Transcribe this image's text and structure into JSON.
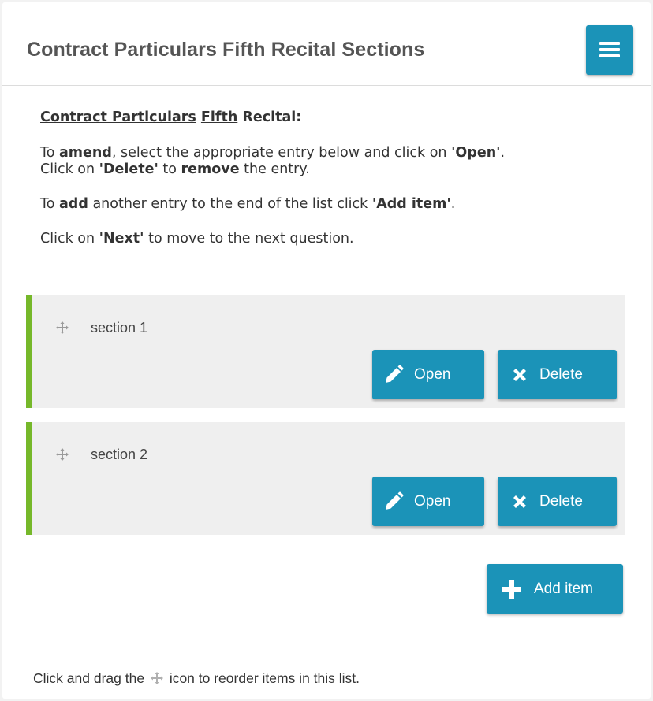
{
  "header": {
    "title": "Contract Particulars Fifth Recital Sections",
    "menu_icon": "hamburger-menu-icon"
  },
  "instructions": {
    "heading_part1": "Contract Particulars",
    "heading_part2": "Fifth",
    "heading_part3": "Recital:",
    "line1_prefix": "To ",
    "line1_amend": "amend",
    "line1_mid": ", select the appropriate entry below and click on ",
    "line1_open": "'Open'",
    "line1_end": ".",
    "line2_prefix": "Click on ",
    "line2_delete": "'Delete'",
    "line2_mid": " to ",
    "line2_remove": "remove",
    "line2_end": " the entry.",
    "line3_prefix": "To ",
    "line3_add": "add",
    "line3_mid": " another entry to the end of the list click ",
    "line3_additem": "'Add item'",
    "line3_end": ".",
    "line4_prefix": "Click on ",
    "line4_next": "'Next'",
    "line4_end": " to move to the next question."
  },
  "items": [
    {
      "label": "section 1",
      "open_label": "Open",
      "delete_label": "Delete"
    },
    {
      "label": "section 2",
      "open_label": "Open",
      "delete_label": "Delete"
    }
  ],
  "add_button": {
    "label": "Add item"
  },
  "footer": {
    "before": "Click and drag the",
    "after": "icon to reorder items in this list."
  },
  "colors": {
    "accent": "#1b93b8",
    "item_border": "#76b82a",
    "item_bg": "#efefef"
  }
}
